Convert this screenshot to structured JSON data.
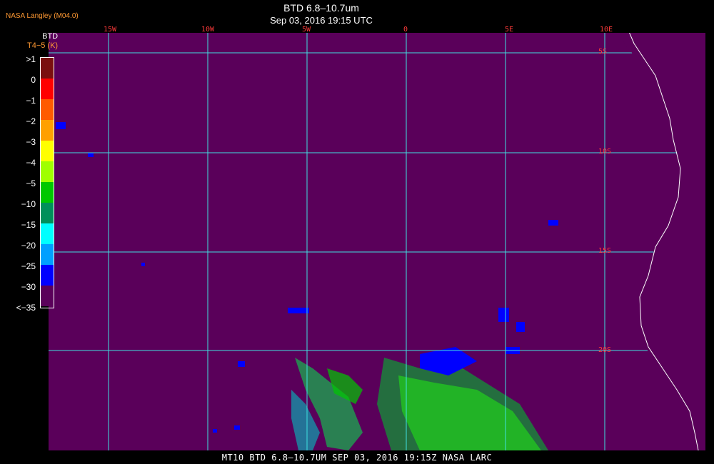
{
  "header": {
    "credit": "NASA Langley (M04.0)",
    "title": "BTD 6.8–10.7um",
    "timestamp": "Sep 03, 2016 19:15 UTC"
  },
  "legend": {
    "label": "BTD",
    "sublabel": "T4−5 (K)",
    "ticks": [
      ">1",
      "0",
      "−1",
      "−2",
      "−3",
      "−4",
      "−5",
      "−10",
      "−15",
      "−20",
      "−25",
      "−30",
      "<−35"
    ],
    "colors": [
      "#7a0f0f",
      "#ff0000",
      "#ff5a00",
      "#ffa000",
      "#ffff00",
      "#a0ff00",
      "#00c800",
      "#00905a",
      "#00ffff",
      "#00a0ff",
      "#0000ff",
      "#5a005a"
    ]
  },
  "grid": {
    "lon_labels": [
      "15W",
      "10W",
      "5W",
      "0",
      "5E",
      "10E"
    ],
    "lat_labels": [
      "5S",
      "10S",
      "15S",
      "20S"
    ]
  },
  "colors": {
    "background": "#5a005a",
    "grid": "#40e0e0",
    "coast": "#ffffff",
    "grid_label": "#ff3a3a"
  },
  "footer": {
    "text": "MT10  BTD 6.8–10.7UM   SEP 03, 2016 19:15Z   NASA LARC"
  }
}
